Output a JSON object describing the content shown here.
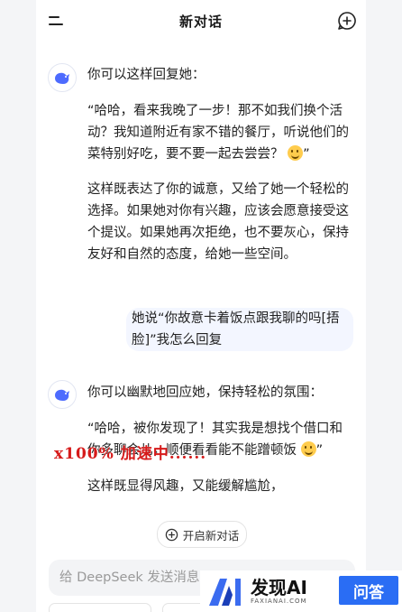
{
  "header": {
    "title": "新对话"
  },
  "ai_message_1": {
    "intro": "你可以这样回复她：",
    "quote": "“哈哈，看来我晚了一步！那不如我们换个活动？我知道附近有家不错的餐厅，听说他们的菜特别好吃，要不要一起去尝尝？",
    "quote_end": "”",
    "explanation": "这样既表达了你的诚意，又给了她一个轻松的选择。如果她对你有兴趣，应该会愿意接受这个提议。如果她再次拒绝，也不要灰心，保持友好和自然的态度，给她一些空间。"
  },
  "user_message": {
    "text": "她说“你故意卡着饭点跟我聊的吗[捂脸]”我怎么回复"
  },
  "ai_message_2": {
    "intro": "你可以幽默地回应她，保持轻松的氛围：",
    "quote": "“哈哈，被你发现了！其实我是想找个借口和你多聊会儿，顺便看看能不能蹭顿饭",
    "quote_end": "”",
    "explanation": "这样既显得风趣，又能缓解尴尬，"
  },
  "overlay": {
    "loading_text": "x100% 加速中......"
  },
  "new_chat_button": {
    "label": "开启新对话"
  },
  "input": {
    "placeholder": "给 DeepSeek 发送消息"
  },
  "brand_badge": {
    "name": "发现AI",
    "sub": "FAXIANAI.COM",
    "qa": "问答"
  },
  "icons": {
    "menu": "menu-icon",
    "new_chat": "new-chat-icon",
    "avatar": "deepseek-whale-icon",
    "emoji": "smile-emoji-icon",
    "plus": "plus-circle-icon"
  }
}
